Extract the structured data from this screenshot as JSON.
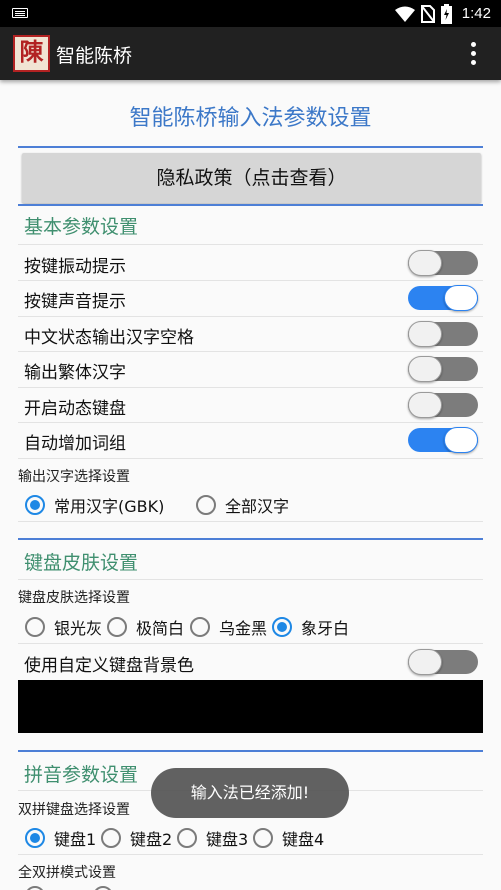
{
  "status_bar": {
    "time": "1:42"
  },
  "app_bar": {
    "logo_char": "陳",
    "title": "智能陈桥"
  },
  "page": {
    "title": "智能陈桥输入法参数设置",
    "privacy_button": "隐私政策（点击查看）"
  },
  "basic": {
    "header": "基本参数设置",
    "toggles": [
      {
        "label": "按键振动提示",
        "checked": false
      },
      {
        "label": "按键声音提示",
        "checked": true
      },
      {
        "label": "中文状态输出汉字空格",
        "checked": false
      },
      {
        "label": "输出繁体汉字",
        "checked": false
      },
      {
        "label": "开启动态键盘",
        "checked": false
      },
      {
        "label": "自动增加词组",
        "checked": true
      }
    ],
    "output_label": "输出汉字选择设置",
    "output_options": [
      "常用汉字(GBK)",
      "全部汉字"
    ],
    "output_selected": "常用汉字(GBK)"
  },
  "skin": {
    "header": "键盘皮肤设置",
    "select_label": "键盘皮肤选择设置",
    "options": [
      "银光灰",
      "极简白",
      "乌金黑",
      "象牙白"
    ],
    "selected": "象牙白",
    "custom_bg_label": "使用自定义键盘背景色",
    "custom_bg_checked": false,
    "custom_bg_color": "#000000"
  },
  "pinyin": {
    "header": "拼音参数设置",
    "shuangpin_label": "双拼键盘选择设置",
    "keyboards": [
      "键盘1",
      "键盘2",
      "键盘3",
      "键盘4"
    ],
    "selected": "键盘1",
    "full_label": "全双拼模式设置"
  },
  "toast": "输入法已经添加!"
}
